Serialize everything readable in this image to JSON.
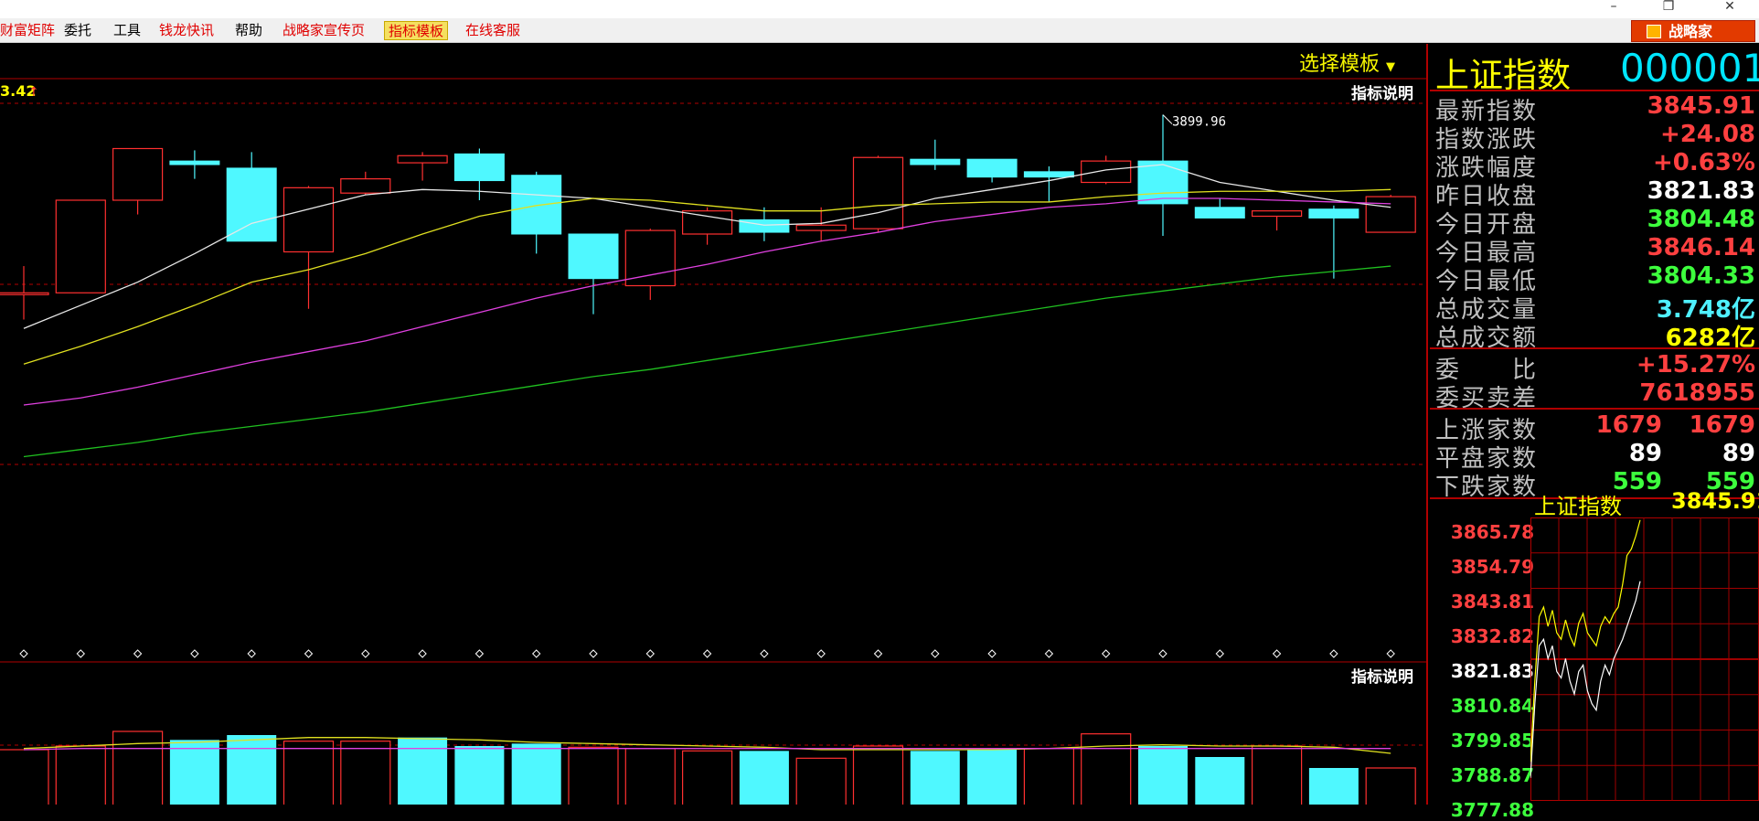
{
  "menu": {
    "items": [
      {
        "label": "财富矩阵",
        "color": "#e00000",
        "active": false
      },
      {
        "label": "委托",
        "color": "#000000",
        "active": false
      },
      {
        "label": "工具",
        "color": "#000000",
        "active": false
      },
      {
        "label": "钱龙快讯",
        "color": "#e00000",
        "active": false
      },
      {
        "label": "帮助",
        "color": "#000000",
        "active": false
      },
      {
        "label": "战略家宣传页",
        "color": "#e00000",
        "active": false
      },
      {
        "label": "指标模板",
        "color": "#e00000",
        "active": true
      },
      {
        "label": "在线客服",
        "color": "#e00000",
        "active": false
      }
    ],
    "brand_label": "战略家"
  },
  "chart": {
    "template_label": "选择模板",
    "explain_label": "指标说明",
    "top_left_value": "3.42",
    "peak_annotation": "3899.96"
  },
  "side": {
    "name": "上证指数",
    "code": "000001",
    "quote_rows": [
      {
        "label": "最新指数",
        "value": "3845.91",
        "color": "#ff4040"
      },
      {
        "label": "指数涨跌",
        "value": "+24.08",
        "color": "#ff4040"
      },
      {
        "label": "涨跌幅度",
        "value": "+0.63%",
        "color": "#ff4040"
      },
      {
        "label": "昨日收盘",
        "value": "3821.83",
        "color": "#ffffff"
      },
      {
        "label": "今日开盘",
        "value": "3804.48",
        "color": "#3dff3d"
      },
      {
        "label": "今日最高",
        "value": "3846.14",
        "color": "#ff4040"
      },
      {
        "label": "今日最低",
        "value": "3804.33",
        "color": "#3dff3d"
      },
      {
        "label": "总成交量",
        "value": "3.748亿",
        "color": "#4ff0ff"
      },
      {
        "label": "总成交额",
        "value": "6282亿",
        "color": "#ffff00"
      }
    ],
    "order_rows": [
      {
        "label": "委　　比",
        "value": "+15.27%",
        "color": "#ff4040"
      },
      {
        "label": "委买卖差",
        "value": "7618955",
        "color": "#ff4040"
      }
    ],
    "breadth_rows": [
      {
        "label": "上涨家数",
        "value": "1679",
        "value2": "1679",
        "color": "#ff4040"
      },
      {
        "label": "平盘家数",
        "value": "89",
        "value2": "89",
        "color": "#ffffff"
      },
      {
        "label": "下跌家数",
        "value": "559",
        "value2": "559",
        "color": "#3dff3d"
      }
    ]
  },
  "mini_chart": {
    "title": "上证指数",
    "value": "3845.91",
    "ticks": [
      {
        "label": "3865.78",
        "color": "#ff4040"
      },
      {
        "label": "3854.79",
        "color": "#ff4040"
      },
      {
        "label": "3843.81",
        "color": "#ff4040"
      },
      {
        "label": "3832.82",
        "color": "#ff4040"
      },
      {
        "label": "3821.83",
        "color": "#ffffff"
      },
      {
        "label": "3810.84",
        "color": "#3dff3d"
      },
      {
        "label": "3799.85",
        "color": "#3dff3d"
      },
      {
        "label": "3788.87",
        "color": "#3dff3d"
      },
      {
        "label": "3777.88",
        "color": "#3dff3d"
      }
    ]
  },
  "chart_data": {
    "type": "candlestick",
    "title": "",
    "candles": [
      {
        "open": 3800,
        "close": 3800,
        "high": 3815,
        "low": 3785,
        "color": "up"
      },
      {
        "open": 3800,
        "close": 3852,
        "high": 3852,
        "low": 3800,
        "color": "up"
      },
      {
        "open": 3852,
        "close": 3881,
        "high": 3881,
        "low": 3844,
        "color": "up"
      },
      {
        "open": 3874,
        "close": 3872,
        "high": 3880,
        "low": 3864,
        "color": "down"
      },
      {
        "open": 3870,
        "close": 3829,
        "high": 3879,
        "low": 3829,
        "color": "down"
      },
      {
        "open": 3823,
        "close": 3859,
        "high": 3860,
        "low": 3791,
        "color": "up"
      },
      {
        "open": 3856,
        "close": 3864,
        "high": 3868,
        "low": 3855,
        "color": "up"
      },
      {
        "open": 3873,
        "close": 3877,
        "high": 3879,
        "low": 3863,
        "color": "up"
      },
      {
        "open": 3878,
        "close": 3863,
        "high": 3881,
        "low": 3852,
        "color": "down"
      },
      {
        "open": 3866,
        "close": 3833,
        "high": 3868,
        "low": 3822,
        "color": "down"
      },
      {
        "open": 3833,
        "close": 3808,
        "high": 3833,
        "low": 3788,
        "color": "down"
      },
      {
        "open": 3804,
        "close": 3835,
        "high": 3836,
        "low": 3796,
        "color": "up"
      },
      {
        "open": 3833,
        "close": 3846,
        "high": 3848,
        "low": 3827,
        "color": "up"
      },
      {
        "open": 3841,
        "close": 3834,
        "high": 3848,
        "low": 3829,
        "color": "down"
      },
      {
        "open": 3835,
        "close": 3838,
        "high": 3848,
        "low": 3829,
        "color": "up"
      },
      {
        "open": 3836,
        "close": 3876,
        "high": 3877,
        "low": 3834,
        "color": "up"
      },
      {
        "open": 3875,
        "close": 3872,
        "high": 3886,
        "low": 3869,
        "color": "down"
      },
      {
        "open": 3875,
        "close": 3865,
        "high": 3875,
        "low": 3862,
        "color": "down"
      },
      {
        "open": 3868,
        "close": 3865,
        "high": 3871,
        "low": 3851,
        "color": "down"
      },
      {
        "open": 3862,
        "close": 3874,
        "high": 3877,
        "low": 3861,
        "color": "up"
      },
      {
        "open": 3874,
        "close": 3850,
        "high": 3899.96,
        "low": 3832,
        "color": "down"
      },
      {
        "open": 3848,
        "close": 3842,
        "high": 3853,
        "low": 3842,
        "color": "down"
      },
      {
        "open": 3843,
        "close": 3846,
        "high": 3846,
        "low": 3835,
        "color": "up"
      },
      {
        "open": 3847,
        "close": 3842,
        "high": 3849,
        "low": 3808,
        "color": "down"
      },
      {
        "open": 3834,
        "close": 3854,
        "high": 3855,
        "low": 3834,
        "color": "up"
      }
    ],
    "ma_white": [
      3780,
      3793,
      3806,
      3822,
      3839,
      3847,
      3855,
      3858,
      3857,
      3855,
      3853,
      3848,
      3843,
      3838,
      3839,
      3845,
      3853,
      3858,
      3863,
      3869,
      3872,
      3862,
      3857,
      3852,
      3848
    ],
    "ma_yellow": [
      3760,
      3770,
      3781,
      3793,
      3806,
      3813,
      3822,
      3833,
      3843,
      3849,
      3853,
      3852,
      3849,
      3846,
      3846,
      3849,
      3850,
      3851,
      3851,
      3854,
      3856,
      3857,
      3857,
      3857,
      3858
    ],
    "ma_magenta": [
      3737,
      3741,
      3747,
      3754,
      3761,
      3767,
      3773,
      3781,
      3789,
      3797,
      3804,
      3810,
      3816,
      3823,
      3829,
      3834,
      3840,
      3844,
      3848,
      3850,
      3853,
      3853,
      3852,
      3851,
      3850
    ],
    "ma_green": [
      3708,
      3712,
      3716,
      3721,
      3725,
      3729,
      3733,
      3738,
      3743,
      3748,
      3753,
      3757,
      3762,
      3767,
      3772,
      3777,
      3782,
      3787,
      3792,
      3797,
      3801,
      3805,
      3809,
      3812,
      3815
    ],
    "volume": [
      {
        "v": 85,
        "color": "up"
      },
      {
        "v": 88,
        "color": "up"
      },
      {
        "v": 100,
        "color": "up"
      },
      {
        "v": 93,
        "color": "down"
      },
      {
        "v": 97,
        "color": "down"
      },
      {
        "v": 92,
        "color": "up"
      },
      {
        "v": 92,
        "color": "up"
      },
      {
        "v": 95,
        "color": "down"
      },
      {
        "v": 88,
        "color": "down"
      },
      {
        "v": 90,
        "color": "down"
      },
      {
        "v": 87,
        "color": "up"
      },
      {
        "v": 86,
        "color": "up"
      },
      {
        "v": 84,
        "color": "up"
      },
      {
        "v": 84,
        "color": "down"
      },
      {
        "v": 78,
        "color": "up"
      },
      {
        "v": 88,
        "color": "up"
      },
      {
        "v": 84,
        "color": "down"
      },
      {
        "v": 85,
        "color": "down"
      },
      {
        "v": 86,
        "color": "up"
      },
      {
        "v": 98,
        "color": "up"
      },
      {
        "v": 88,
        "color": "down"
      },
      {
        "v": 79,
        "color": "down"
      },
      {
        "v": 88,
        "color": "up"
      },
      {
        "v": 70,
        "color": "down"
      },
      {
        "v": 70,
        "color": "up"
      }
    ],
    "vol_ma_yellow": [
      86,
      88,
      90,
      91,
      93,
      95,
      95,
      94,
      93,
      91,
      90,
      89,
      88,
      87,
      85,
      85,
      85,
      85,
      86,
      88,
      89,
      88,
      88,
      87,
      82
    ],
    "vol_ma_magenta": [
      85,
      86,
      86,
      86,
      86,
      86,
      86,
      86,
      86,
      86,
      86,
      86,
      86,
      86,
      86,
      86,
      86,
      86,
      86,
      86,
      86,
      86,
      86,
      86,
      86
    ],
    "ylim": [
      3660,
      3910
    ],
    "mini_series_yellow": [
      3790,
      3815,
      3835,
      3838,
      3832,
      3837,
      3830,
      3828,
      3834,
      3829,
      3826,
      3833,
      3836,
      3830,
      3828,
      3826,
      3832,
      3835,
      3833,
      3836,
      3838,
      3845,
      3854,
      3856,
      3860,
      3865
    ],
    "mini_series_white": [
      3785,
      3808,
      3826,
      3828,
      3822,
      3826,
      3818,
      3816,
      3822,
      3815,
      3811,
      3818,
      3820,
      3812,
      3808,
      3806,
      3815,
      3820,
      3817,
      3822,
      3825,
      3828,
      3832,
      3836,
      3840,
      3846
    ],
    "mini_ylim": [
      3777.88,
      3865.78
    ]
  }
}
